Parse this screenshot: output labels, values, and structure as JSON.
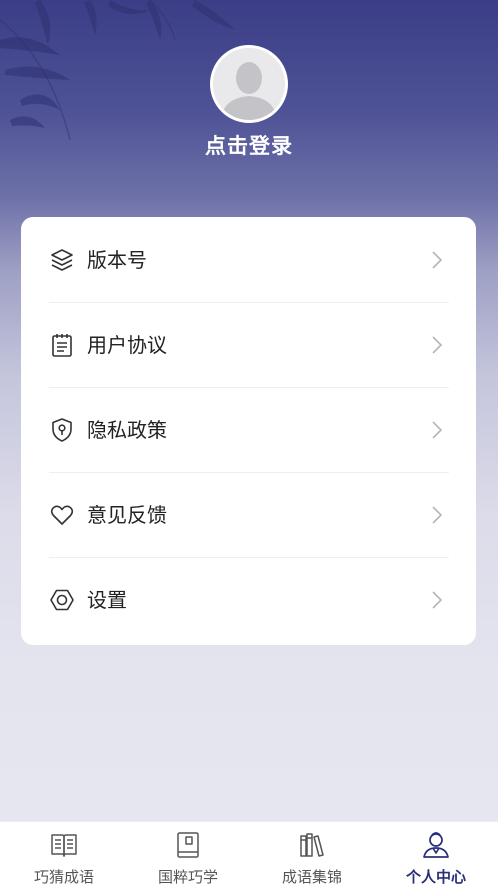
{
  "profile": {
    "avatar_icon": "default-user-avatar",
    "login_text": "点击登录"
  },
  "menu": {
    "items": [
      {
        "label": "版本号",
        "icon": "layers-icon"
      },
      {
        "label": "用户协议",
        "icon": "notepad-icon"
      },
      {
        "label": "隐私政策",
        "icon": "shield-keyhole-icon"
      },
      {
        "label": "意见反馈",
        "icon": "heart-icon"
      },
      {
        "label": "设置",
        "icon": "hexagon-settings-icon"
      }
    ],
    "chevron_icon": "chevron-right-icon"
  },
  "tabbar": {
    "tabs": [
      {
        "label": "巧猜成语",
        "icon": "open-book-icon",
        "active": false
      },
      {
        "label": "国粹巧学",
        "icon": "closed-book-icon",
        "active": false
      },
      {
        "label": "成语集锦",
        "icon": "bookshelf-icon",
        "active": false
      },
      {
        "label": "个人中心",
        "icon": "user-profile-icon",
        "active": true
      }
    ]
  },
  "colors": {
    "header_top": "#3b3e86",
    "background_bottom": "#e6e6f0",
    "active_tab": "#2b2f7a",
    "inactive_tab": "#555555",
    "card": "#ffffff"
  }
}
